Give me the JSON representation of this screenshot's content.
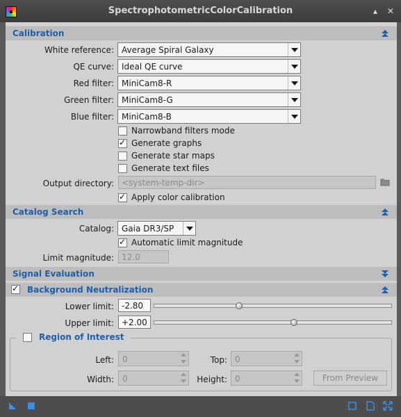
{
  "window": {
    "title": "SpectrophotometricColorCalibration"
  },
  "calibration": {
    "title": "Calibration",
    "white_reference": {
      "label": "White reference:",
      "value": "Average Spiral Galaxy"
    },
    "qe_curve": {
      "label": "QE curve:",
      "value": "Ideal QE curve"
    },
    "red_filter": {
      "label": "Red filter:",
      "value": "MiniCam8-R"
    },
    "green_filter": {
      "label": "Green filter:",
      "value": "MiniCam8-G"
    },
    "blue_filter": {
      "label": "Blue filter:",
      "value": "MiniCam8-B"
    },
    "checks": {
      "narrowband": {
        "label": "Narrowband filters mode",
        "checked": false
      },
      "graphs": {
        "label": "Generate graphs",
        "checked": true
      },
      "star_maps": {
        "label": "Generate star maps",
        "checked": false
      },
      "text_files": {
        "label": "Generate text files",
        "checked": false
      }
    },
    "output_directory": {
      "label": "Output directory:",
      "placeholder": "<system-temp-dir>"
    },
    "apply": {
      "label": "Apply color calibration",
      "checked": true
    }
  },
  "catalog_search": {
    "title": "Catalog Search",
    "catalog": {
      "label": "Catalog:",
      "value": "Gaia DR3/SP"
    },
    "auto_limit": {
      "label": "Automatic limit magnitude",
      "checked": true
    },
    "limit_magnitude": {
      "label": "Limit magnitude:",
      "value": "12.0"
    }
  },
  "signal_evaluation": {
    "title": "Signal Evaluation"
  },
  "background_neutralization": {
    "title": "Background Neutralization",
    "enabled": true,
    "lower_limit": {
      "label": "Lower limit:",
      "value": "-2.80",
      "slider_fraction": 0.36
    },
    "upper_limit": {
      "label": "Upper limit:",
      "value": "+2.00",
      "slider_fraction": 0.59
    },
    "roi": {
      "title": "Region of Interest",
      "enabled": false,
      "left": {
        "label": "Left:",
        "value": "0"
      },
      "top": {
        "label": "Top:",
        "value": "0"
      },
      "width": {
        "label": "Width:",
        "value": "0"
      },
      "height": {
        "label": "Height:",
        "value": "0"
      },
      "from_preview": "From Preview"
    }
  },
  "colors": {
    "section_title": "#1f5ea8",
    "panel": "#d1d1d1",
    "section_bar": "#bdbdbd",
    "frame": "#4d4d4d"
  },
  "icons": [
    "new-instance-icon",
    "execute-icon",
    "browse-folder-icon",
    "collapse-icon",
    "expand-icon",
    "preview-icon",
    "reset-icon",
    "shade-icon",
    "close-icon"
  ]
}
